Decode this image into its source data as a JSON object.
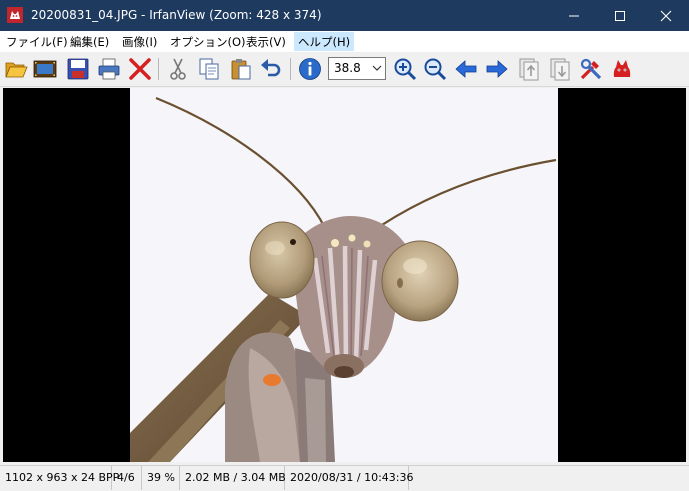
{
  "window": {
    "title": "20200831_04.JPG - IrfanView (Zoom: 428 x 374)",
    "app_icon": "irfanview-cat-icon",
    "controls": [
      "minimize-icon",
      "maximize-icon",
      "close-icon"
    ]
  },
  "menu": [
    {
      "label": "ファイル(F)"
    },
    {
      "label": "編集(E)"
    },
    {
      "label": "画像(I)"
    },
    {
      "label": "オプション(O)"
    },
    {
      "label": "表示(V)"
    },
    {
      "label": "ヘルプ(H)",
      "active": true
    }
  ],
  "toolbar": {
    "icons": [
      "open-folder-icon",
      "slideshow-icon",
      "save-icon",
      "print-icon",
      "delete-icon",
      "cut-icon",
      "copy-icon",
      "paste-icon",
      "undo-icon",
      "info-icon",
      "zoom-in-icon",
      "zoom-out-icon",
      "previous-icon",
      "next-icon",
      "first-page-icon",
      "last-page-icon",
      "properties-icon",
      "about-icon"
    ],
    "zoom_value": "38.8"
  },
  "image": {
    "description": "close-up photo of a praying mantis head"
  },
  "status": {
    "dimensions": "1102 x 963 x 24 BPP",
    "index": "4/6",
    "zoom": "39 %",
    "size": "2.02 MB / 3.04 MB",
    "datetime": "2020/08/31 / 10:43:36"
  },
  "colors": {
    "titlebar": "#1e3a5f",
    "menu_active": "#cce8ff",
    "viewport_bg": "#000000"
  }
}
